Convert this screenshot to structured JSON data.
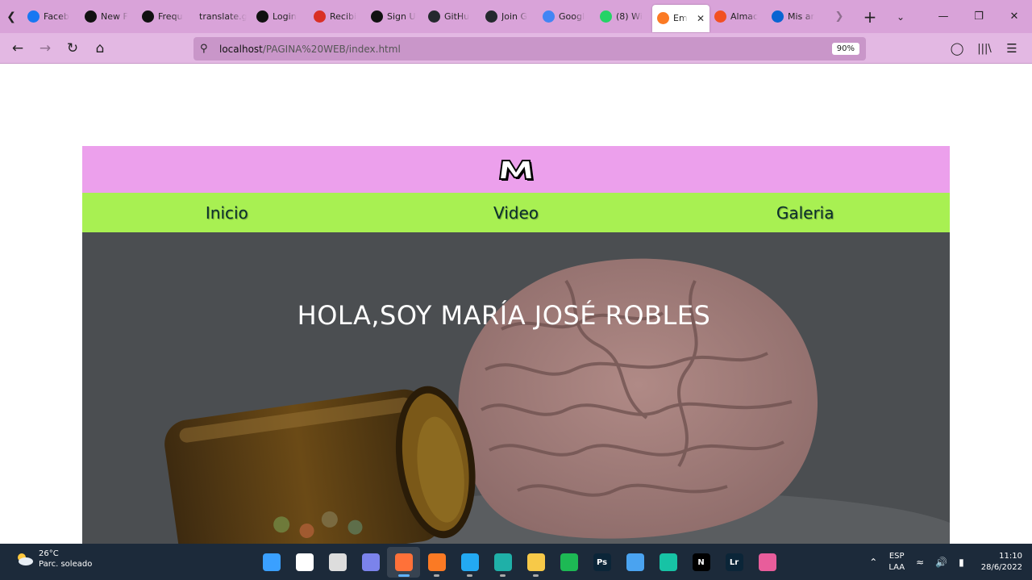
{
  "browser": {
    "tabs": [
      {
        "label": "Faceb",
        "icon": "facebook-icon",
        "color": "#1877f2"
      },
      {
        "label": "New F",
        "icon": "triangle-logo-icon",
        "color": "#111111"
      },
      {
        "label": "Frequ",
        "icon": "triangle-logo-icon",
        "color": "#111111"
      },
      {
        "label": "translate.g",
        "icon": "",
        "color": ""
      },
      {
        "label": "Login",
        "icon": "triangle-logo-icon",
        "color": "#111111"
      },
      {
        "label": "Recibi",
        "icon": "gmail-icon",
        "color": "#d93025"
      },
      {
        "label": "Sign U",
        "icon": "triangle-logo-icon",
        "color": "#111111"
      },
      {
        "label": "GitHu",
        "icon": "github-icon",
        "color": "#24292e"
      },
      {
        "label": "Join G",
        "icon": "github-icon",
        "color": "#24292e"
      },
      {
        "label": "Googl",
        "icon": "google-translate-icon",
        "color": "#4285f4"
      },
      {
        "label": "(8) Wi",
        "icon": "whatsapp-icon",
        "color": "#25d366"
      },
      {
        "label": "Em",
        "icon": "xampp-icon",
        "color": "#fb7a24",
        "active": true
      },
      {
        "label": "Almac",
        "icon": "microsoft-icon",
        "color": "#f25022"
      },
      {
        "label": "Mis ar",
        "icon": "onedrive-icon",
        "color": "#0a64d2"
      }
    ],
    "url_host": "localhost",
    "url_path": "/PAGINA%20WEB/index.html",
    "zoom": "90%"
  },
  "site": {
    "logo_alt": "M",
    "nav": [
      "Inicio",
      "Video",
      "Galeria"
    ],
    "hero_title": "HOLA,SOY MARÍA JOSÉ ROBLES"
  },
  "taskbar": {
    "temp": "26°C",
    "weather": "Parc. soleado",
    "apps": [
      {
        "name": "windows-start-icon",
        "color": "#3aa0ff",
        "label": ""
      },
      {
        "name": "search-icon",
        "color": "#ffffff",
        "label": ""
      },
      {
        "name": "task-view-icon",
        "color": "#dddddd",
        "label": ""
      },
      {
        "name": "teams-chat-icon",
        "color": "#7b83eb",
        "label": ""
      },
      {
        "name": "firefox-icon",
        "color": "#ff7139",
        "label": "",
        "active": true
      },
      {
        "name": "xampp-icon",
        "color": "#fb7a24",
        "label": ""
      },
      {
        "name": "vscode-icon",
        "color": "#23a9f2",
        "label": ""
      },
      {
        "name": "edge-icon",
        "color": "#1fb0a8",
        "label": ""
      },
      {
        "name": "file-explorer-icon",
        "color": "#f7c948",
        "label": ""
      },
      {
        "name": "spotify-icon",
        "color": "#1db954",
        "label": ""
      },
      {
        "name": "photoshop-icon",
        "color": "#0b2538",
        "label": "Ps"
      },
      {
        "name": "store-icon",
        "color": "#4aa3f0",
        "label": ""
      },
      {
        "name": "filmora-icon",
        "color": "#17c3a5",
        "label": ""
      },
      {
        "name": "netflix-icon",
        "color": "#000000",
        "label": "N"
      },
      {
        "name": "lightroom-icon",
        "color": "#0b2538",
        "label": "Lr"
      },
      {
        "name": "cube-app-icon",
        "color": "#e85d9b",
        "label": ""
      }
    ],
    "lang": "ESP",
    "layout": "LAA",
    "time": "11:10",
    "date": "28/6/2022"
  }
}
